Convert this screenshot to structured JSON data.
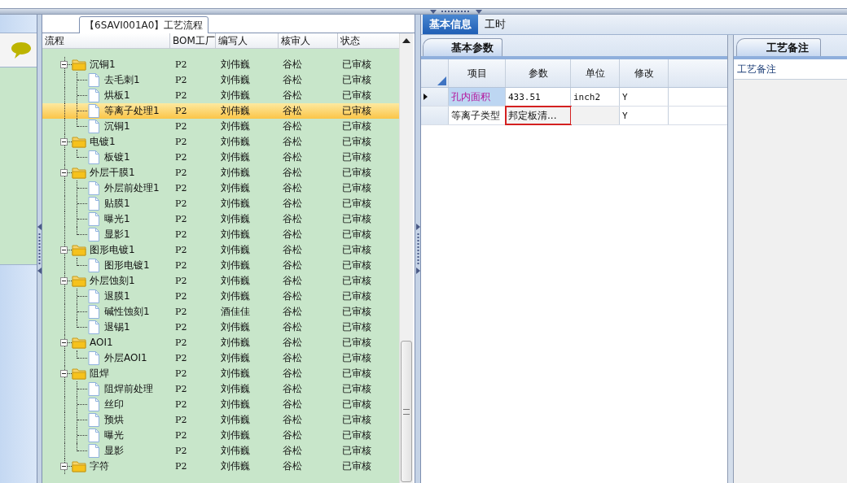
{
  "tree_panel": {
    "title": "【6SAVI001A0】工艺流程"
  },
  "tree_columns": [
    "流程",
    "BOM工厂",
    "编写人",
    "核审人",
    "状态"
  ],
  "tree": [
    {
      "kind": "folder",
      "name": "沉铜1",
      "bom": "P2",
      "writer": "刘伟巍",
      "reviewer": "谷松",
      "status": "已审核",
      "selected": false,
      "expanded": true,
      "children": [
        {
          "kind": "file",
          "name": "去毛刺1",
          "bom": "P2",
          "writer": "刘伟巍",
          "reviewer": "谷松",
          "status": "已审核",
          "selected": false
        },
        {
          "kind": "file",
          "name": "烘板1",
          "bom": "P2",
          "writer": "刘伟巍",
          "reviewer": "谷松",
          "status": "已审核",
          "selected": false
        },
        {
          "kind": "file",
          "name": "等离子处理1",
          "bom": "P2",
          "writer": "刘伟巍",
          "reviewer": "谷松",
          "status": "已审核",
          "selected": true
        },
        {
          "kind": "file",
          "name": "沉铜1",
          "bom": "P2",
          "writer": "刘伟巍",
          "reviewer": "谷松",
          "status": "已审核",
          "selected": false
        }
      ]
    },
    {
      "kind": "folder",
      "name": "电镀1",
      "bom": "P2",
      "writer": "刘伟巍",
      "reviewer": "谷松",
      "status": "已审核",
      "selected": false,
      "expanded": true,
      "children": [
        {
          "kind": "file",
          "name": "板镀1",
          "bom": "P2",
          "writer": "刘伟巍",
          "reviewer": "谷松",
          "status": "已审核",
          "selected": false
        }
      ]
    },
    {
      "kind": "folder",
      "name": "外层干膜1",
      "bom": "P2",
      "writer": "刘伟巍",
      "reviewer": "谷松",
      "status": "已审核",
      "selected": false,
      "expanded": true,
      "children": [
        {
          "kind": "file",
          "name": "外层前处理1",
          "bom": "P2",
          "writer": "刘伟巍",
          "reviewer": "谷松",
          "status": "已审核",
          "selected": false
        },
        {
          "kind": "file",
          "name": "贴膜1",
          "bom": "P2",
          "writer": "刘伟巍",
          "reviewer": "谷松",
          "status": "已审核",
          "selected": false
        },
        {
          "kind": "file",
          "name": "曝光1",
          "bom": "P2",
          "writer": "刘伟巍",
          "reviewer": "谷松",
          "status": "已审核",
          "selected": false
        },
        {
          "kind": "file",
          "name": "显影1",
          "bom": "P2",
          "writer": "刘伟巍",
          "reviewer": "谷松",
          "status": "已审核",
          "selected": false
        }
      ]
    },
    {
      "kind": "folder",
      "name": "图形电镀1",
      "bom": "P2",
      "writer": "刘伟巍",
      "reviewer": "谷松",
      "status": "已审核",
      "selected": false,
      "expanded": true,
      "children": [
        {
          "kind": "file",
          "name": "图形电镀1",
          "bom": "P2",
          "writer": "刘伟巍",
          "reviewer": "谷松",
          "status": "已审核",
          "selected": false
        }
      ]
    },
    {
      "kind": "folder",
      "name": "外层蚀刻1",
      "bom": "P2",
      "writer": "刘伟巍",
      "reviewer": "谷松",
      "status": "已审核",
      "selected": false,
      "expanded": true,
      "children": [
        {
          "kind": "file",
          "name": "退膜1",
          "bom": "P2",
          "writer": "刘伟巍",
          "reviewer": "谷松",
          "status": "已审核",
          "selected": false
        },
        {
          "kind": "file",
          "name": "碱性蚀刻1",
          "bom": "P2",
          "writer": "酒佳佳",
          "reviewer": "谷松",
          "status": "已审核",
          "selected": false
        },
        {
          "kind": "file",
          "name": "退锡1",
          "bom": "P2",
          "writer": "刘伟巍",
          "reviewer": "谷松",
          "status": "已审核",
          "selected": false
        }
      ]
    },
    {
      "kind": "folder",
      "name": "AOI1",
      "bom": "P2",
      "writer": "刘伟巍",
      "reviewer": "谷松",
      "status": "已审核",
      "selected": false,
      "expanded": true,
      "children": [
        {
          "kind": "file",
          "name": "外层AOI1",
          "bom": "P2",
          "writer": "刘伟巍",
          "reviewer": "谷松",
          "status": "已审核",
          "selected": false
        }
      ]
    },
    {
      "kind": "folder",
      "name": "阻焊",
      "bom": "P2",
      "writer": "刘伟巍",
      "reviewer": "谷松",
      "status": "已审核",
      "selected": false,
      "expanded": true,
      "children": [
        {
          "kind": "file",
          "name": "阻焊前处理",
          "bom": "P2",
          "writer": "刘伟巍",
          "reviewer": "谷松",
          "status": "已审核",
          "selected": false
        },
        {
          "kind": "file",
          "name": "丝印",
          "bom": "P2",
          "writer": "刘伟巍",
          "reviewer": "谷松",
          "status": "已审核",
          "selected": false
        },
        {
          "kind": "file",
          "name": "预烘",
          "bom": "P2",
          "writer": "刘伟巍",
          "reviewer": "谷松",
          "status": "已审核",
          "selected": false
        },
        {
          "kind": "file",
          "name": "曝光",
          "bom": "P2",
          "writer": "刘伟巍",
          "reviewer": "谷松",
          "status": "已审核",
          "selected": false
        },
        {
          "kind": "file",
          "name": "显影",
          "bom": "P2",
          "writer": "刘伟巍",
          "reviewer": "谷松",
          "status": "已审核",
          "selected": false
        }
      ]
    },
    {
      "kind": "folder",
      "name": "字符",
      "bom": "P2",
      "writer": "刘伟巍",
      "reviewer": "谷松",
      "status": "已审核",
      "selected": false,
      "expanded": true
    }
  ],
  "tabs": [
    {
      "label": "基本信息",
      "selected": true
    },
    {
      "label": "工时",
      "selected": false
    }
  ],
  "param_tab": {
    "label": "基本参数"
  },
  "param_columns": [
    "项目",
    "参数",
    "单位",
    "修改"
  ],
  "param_rows": [
    {
      "item": "孔内面积",
      "value": "433.51",
      "unit": "inch2",
      "modified": "Y",
      "current": true,
      "highlighted": false
    },
    {
      "item": "等离子类型",
      "value": "邦定板清...",
      "unit": "",
      "modified": "Y",
      "current": false,
      "highlighted": true
    }
  ],
  "notes_tab": {
    "label": "工艺备注"
  },
  "notes_label": "工艺备注"
}
